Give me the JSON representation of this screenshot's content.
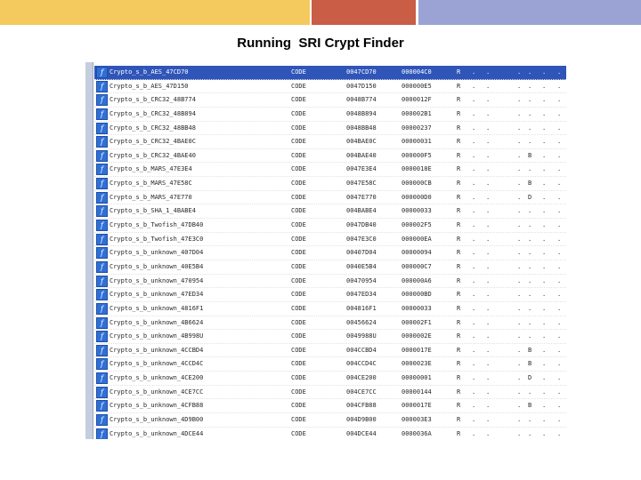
{
  "slide": {
    "title": "Running  SRI Crypt Finder"
  },
  "icon": {
    "name": "function-icon",
    "glyph": "f"
  },
  "rows": [
    {
      "name": "Crypto_s_b_AES_47CD70",
      "segment": "CODE",
      "start": "0047CD70",
      "length": "000004C0",
      "r": "R",
      "f": ".",
      "l": ".",
      "s": ".",
      "b": ".",
      "t": ".",
      "x": "."
    },
    {
      "name": "Crypto_s_b_AES_47D150",
      "segment": "CODE",
      "start": "0047D150",
      "length": "000000E5",
      "r": "R",
      "f": ".",
      "l": ".",
      "s": ".",
      "b": ".",
      "t": ".",
      "x": "."
    },
    {
      "name": "Crypto_s_b_CRC32_48B774",
      "segment": "CODE",
      "start": "0048B774",
      "length": "0000012F",
      "r": "R",
      "f": ".",
      "l": ".",
      "s": ".",
      "b": ".",
      "t": ".",
      "x": "."
    },
    {
      "name": "Crypto_s_b_CRC32_48B894",
      "segment": "CODE",
      "start": "0048B894",
      "length": "000002B1",
      "r": "R",
      "f": ".",
      "l": ".",
      "s": ".",
      "b": ".",
      "t": ".",
      "x": "."
    },
    {
      "name": "Crypto_s_b_CRC32_48BB48",
      "segment": "CODE",
      "start": "0048BB48",
      "length": "00000237",
      "r": "R",
      "f": ".",
      "l": ".",
      "s": ".",
      "b": ".",
      "t": ".",
      "x": "."
    },
    {
      "name": "Crypto_s_b_CRC32_4BAE0C",
      "segment": "CODE",
      "start": "004BAE0C",
      "length": "00000031",
      "r": "R",
      "f": ".",
      "l": ".",
      "s": ".",
      "b": ".",
      "t": ".",
      "x": "."
    },
    {
      "name": "Crypto_s_b_CRC32_4BAE40",
      "segment": "CODE",
      "start": "004BAE40",
      "length": "000000F5",
      "r": "R",
      "f": ".",
      "l": ".",
      "s": ".",
      "b": "B",
      "t": ".",
      "x": "."
    },
    {
      "name": "Crypto_s_b_MARS_47E3E4",
      "segment": "CODE",
      "start": "0047E3E4",
      "length": "0000018E",
      "r": "R",
      "f": ".",
      "l": ".",
      "s": ".",
      "b": ".",
      "t": ".",
      "x": "."
    },
    {
      "name": "Crypto_s_b_MARS_47E58C",
      "segment": "CODE",
      "start": "0047E58C",
      "length": "000000CB",
      "r": "R",
      "f": ".",
      "l": ".",
      "s": ".",
      "b": "B",
      "t": ".",
      "x": "."
    },
    {
      "name": "Crypto_s_b_MARS_47E770",
      "segment": "CODE",
      "start": "0047E770",
      "length": "000000D0",
      "r": "R",
      "f": ".",
      "l": ".",
      "s": ".",
      "b": "D",
      "t": ".",
      "x": "."
    },
    {
      "name": "Crypto_s_b_SHA_1_4BABE4",
      "segment": "CODE",
      "start": "004BABE4",
      "length": "00000033",
      "r": "R",
      "f": ".",
      "l": ".",
      "s": ".",
      "b": ".",
      "t": ".",
      "x": "."
    },
    {
      "name": "Crypto_s_b_Twofish_47DB40",
      "segment": "CODE",
      "start": "0047DB40",
      "length": "000002F5",
      "r": "R",
      "f": ".",
      "l": ".",
      "s": ".",
      "b": ".",
      "t": ".",
      "x": "."
    },
    {
      "name": "Crypto_s_b_Twofish_47E3C0",
      "segment": "CODE",
      "start": "0047E3C0",
      "length": "000000EA",
      "r": "R",
      "f": ".",
      "l": ".",
      "s": ".",
      "b": ".",
      "t": ".",
      "x": "."
    },
    {
      "name": "Crypto_s_b_unknown_407D04",
      "segment": "CODE",
      "start": "00407D04",
      "length": "00000094",
      "r": "R",
      "f": ".",
      "l": ".",
      "s": ".",
      "b": ".",
      "t": ".",
      "x": "."
    },
    {
      "name": "Crypto_s_b_unknown_40E5B4",
      "segment": "CODE",
      "start": "0040E5B4",
      "length": "000000C7",
      "r": "R",
      "f": ".",
      "l": ".",
      "s": ".",
      "b": ".",
      "t": ".",
      "x": "."
    },
    {
      "name": "Crypto_s_b_unknown_470954",
      "segment": "CODE",
      "start": "00470954",
      "length": "000000A6",
      "r": "R",
      "f": ".",
      "l": ".",
      "s": ".",
      "b": ".",
      "t": ".",
      "x": "."
    },
    {
      "name": "Crypto_s_b_unknown_47ED34",
      "segment": "CODE",
      "start": "0047ED34",
      "length": "000000BD",
      "r": "R",
      "f": ".",
      "l": ".",
      "s": ".",
      "b": ".",
      "t": ".",
      "x": "."
    },
    {
      "name": "Crypto_s_b_unknown_4816F1",
      "segment": "CODE",
      "start": "004816F1",
      "length": "00000033",
      "r": "R",
      "f": ".",
      "l": ".",
      "s": ".",
      "b": ".",
      "t": ".",
      "x": "."
    },
    {
      "name": "Crypto_s_b_unknown_4B6624",
      "segment": "CODE",
      "start": "00456624",
      "length": "000002F1",
      "r": "R",
      "f": ".",
      "l": ".",
      "s": ".",
      "b": ".",
      "t": ".",
      "x": "."
    },
    {
      "name": "Crypto_s_b_unknown_4B998U",
      "segment": "CODE",
      "start": "0049988U",
      "length": "0000002E",
      "r": "R",
      "f": ".",
      "l": ".",
      "s": ".",
      "b": ".",
      "t": ".",
      "x": "."
    },
    {
      "name": "Crypto_s_b_unknown_4CCBD4",
      "segment": "CODE",
      "start": "004CCBD4",
      "length": "0000017E",
      "r": "R",
      "f": ".",
      "l": ".",
      "s": ".",
      "b": "B",
      "t": ".",
      "x": "."
    },
    {
      "name": "Crypto_s_b_unknown_4CCD4C",
      "segment": "CODE",
      "start": "004CCD4C",
      "length": "0000023E",
      "r": "R",
      "f": ".",
      "l": ".",
      "s": ".",
      "b": "B",
      "t": ".",
      "x": "."
    },
    {
      "name": "Crypto_s_b_unknown_4CE200",
      "segment": "CODE",
      "start": "004CE200",
      "length": "00000001",
      "r": "R",
      "f": ".",
      "l": ".",
      "s": ".",
      "b": "D",
      "t": ".",
      "x": "."
    },
    {
      "name": "Crypto_s_b_unknown_4CE7CC",
      "segment": "CODE",
      "start": "004CE7CC",
      "length": "00000144",
      "r": "R",
      "f": ".",
      "l": ".",
      "s": ".",
      "b": ".",
      "t": ".",
      "x": "."
    },
    {
      "name": "Crypto_s_b_unknown_4CFB88",
      "segment": "CODE",
      "start": "004CFB88",
      "length": "0000017E",
      "r": "R",
      "f": ".",
      "l": ".",
      "s": ".",
      "b": "B",
      "t": ".",
      "x": "."
    },
    {
      "name": "Crypto_s_b_unknown_4D9B00",
      "segment": "CODE",
      "start": "004D9B00",
      "length": "000003E3",
      "r": "R",
      "f": ".",
      "l": ".",
      "s": ".",
      "b": ".",
      "t": ".",
      "x": "."
    },
    {
      "name": "Crypto_s_b_unknown_4DCE44",
      "segment": "CODE",
      "start": "004DCE44",
      "length": "0000036A",
      "r": "R",
      "f": ".",
      "l": ".",
      "s": ".",
      "b": ".",
      "t": ".",
      "x": "."
    },
    {
      "name": "Crypto_s_b_zlib_48ACFC",
      "segment": "CODE",
      "start": "0048ACFC",
      "length": "000004B5",
      "r": "R",
      "f": ".",
      "l": ".",
      "s": ".",
      "b": ".",
      "t": ".",
      "x": "."
    }
  ]
}
